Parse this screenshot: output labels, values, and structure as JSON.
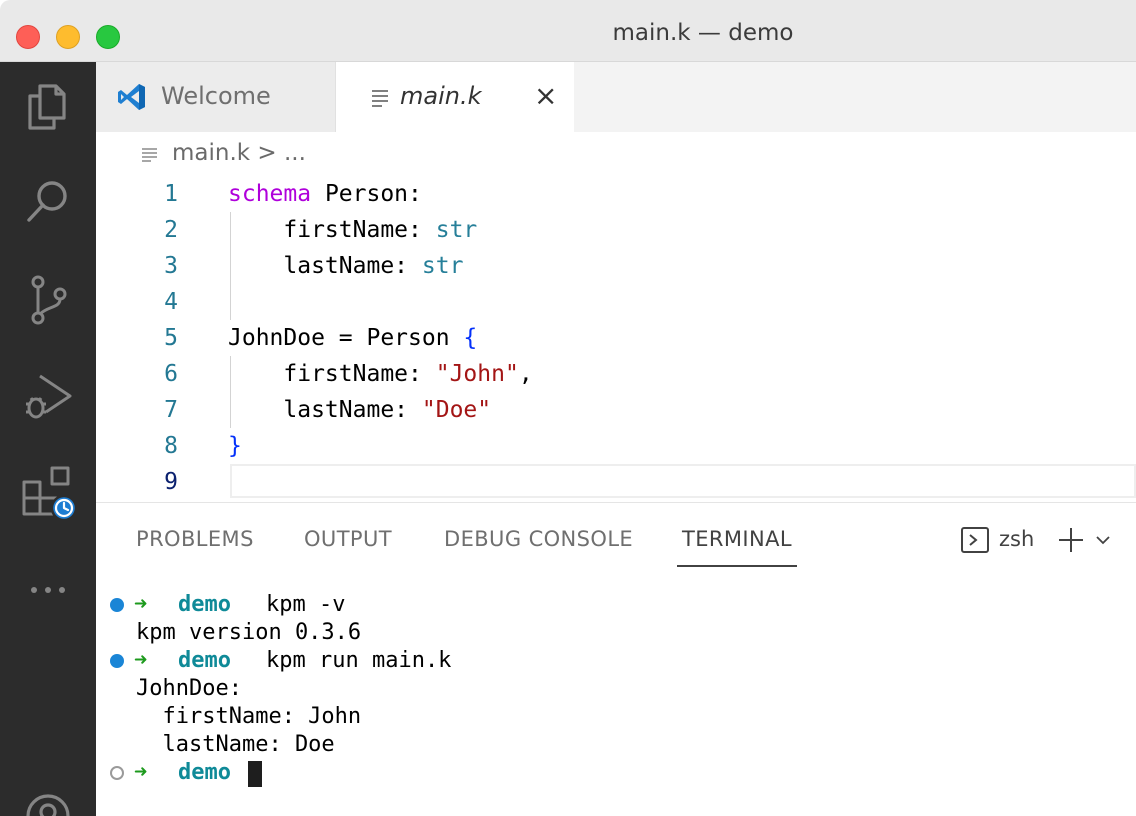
{
  "window": {
    "title": "main.k — demo"
  },
  "activity_bar": {
    "items": [
      {
        "icon": "files-icon"
      },
      {
        "icon": "search-icon"
      },
      {
        "icon": "source-control-icon"
      },
      {
        "icon": "run-debug-icon"
      },
      {
        "icon": "extensions-icon"
      },
      {
        "icon": "more-icon",
        "label": "..."
      },
      {
        "icon": "account-icon"
      }
    ]
  },
  "tabs": [
    {
      "label": "Welcome",
      "icon": "vscode-icon",
      "active": false
    },
    {
      "label": "main.k",
      "icon": "file-lines-icon",
      "active": true,
      "close": "×"
    }
  ],
  "breadcrumb": {
    "text": "main.k > ..."
  },
  "editor": {
    "lines": [
      {
        "num": "1",
        "tokens": [
          {
            "t": "schema",
            "c": "kw"
          },
          {
            "t": " Person:",
            "c": ""
          }
        ]
      },
      {
        "num": "2",
        "tokens": [
          {
            "t": "    firstName: ",
            "c": ""
          },
          {
            "t": "str",
            "c": "ty"
          }
        ]
      },
      {
        "num": "3",
        "tokens": [
          {
            "t": "    lastName: ",
            "c": ""
          },
          {
            "t": "str",
            "c": "ty"
          }
        ]
      },
      {
        "num": "4",
        "tokens": []
      },
      {
        "num": "5",
        "tokens": [
          {
            "t": "JohnDoe = Person ",
            "c": ""
          },
          {
            "t": "{",
            "c": "br"
          }
        ]
      },
      {
        "num": "6",
        "tokens": [
          {
            "t": "    firstName: ",
            "c": ""
          },
          {
            "t": "\"John\"",
            "c": "st"
          },
          {
            "t": ",",
            "c": ""
          }
        ]
      },
      {
        "num": "7",
        "tokens": [
          {
            "t": "    lastName: ",
            "c": ""
          },
          {
            "t": "\"Doe\"",
            "c": "st"
          }
        ]
      },
      {
        "num": "8",
        "tokens": [
          {
            "t": "}",
            "c": "br"
          }
        ]
      },
      {
        "num": "9",
        "tokens": [],
        "current": true
      }
    ]
  },
  "panel": {
    "tabs": [
      {
        "label": "PROBLEMS"
      },
      {
        "label": "OUTPUT"
      },
      {
        "label": "DEBUG CONSOLE"
      },
      {
        "label": "TERMINAL",
        "active": true
      }
    ],
    "terminal_name": "zsh",
    "terminal": [
      {
        "kind": "prompt",
        "status": "ok",
        "arrow": "➜",
        "cwd": "demo",
        "cmd": "kpm -v"
      },
      {
        "kind": "out",
        "text": "kpm version 0.3.6"
      },
      {
        "kind": "prompt",
        "status": "ok",
        "arrow": "➜",
        "cwd": "demo",
        "cmd": "kpm run main.k"
      },
      {
        "kind": "out",
        "text": "JohnDoe:"
      },
      {
        "kind": "out",
        "text": "  firstName: John"
      },
      {
        "kind": "out",
        "text": "  lastName: Doe"
      },
      {
        "kind": "prompt",
        "status": "idle",
        "arrow": "➜",
        "cwd": "demo",
        "cmd": ""
      }
    ]
  }
}
